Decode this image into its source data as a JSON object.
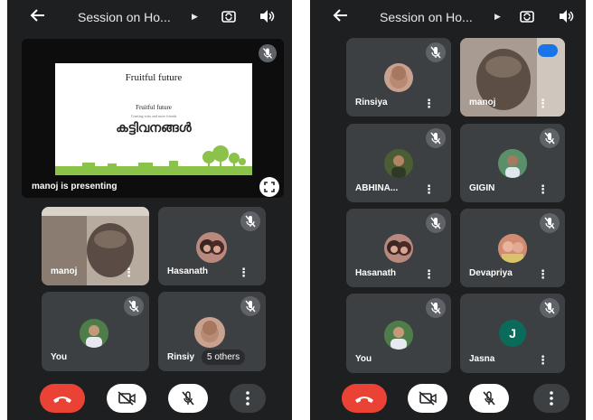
{
  "left": {
    "title": "Session on Ho...",
    "slide": {
      "heading": "Fruitful future",
      "subheading": "Fruitful future",
      "small_text": "Creating wins and more friends",
      "main_text": "കട്ടിവനങ്ങൾ"
    },
    "presenting_label": "manoj is presenting",
    "tiles": [
      {
        "name": "manoj"
      },
      {
        "name": "Hasanath"
      },
      {
        "name": "You"
      },
      {
        "name": "Rinsiy"
      }
    ],
    "others_label": "5 others"
  },
  "right": {
    "title": "Session on Ho...",
    "tiles": [
      {
        "name": "Rinsiya"
      },
      {
        "name": "manoj"
      },
      {
        "name": "ABHINA..."
      },
      {
        "name": "GIGIN"
      },
      {
        "name": "Hasanath"
      },
      {
        "name": "Devapriya"
      },
      {
        "name": "You"
      },
      {
        "name": "Jasna",
        "initial": "J"
      }
    ]
  },
  "icons": {
    "back": "arrow-left-icon",
    "switch_camera": "switch-camera-icon",
    "speaker": "speaker-icon",
    "mic_off": "mic-off-icon",
    "camera_off": "camera-off-icon",
    "end_call": "end-call-icon",
    "more": "more-vert-icon",
    "fullscreen": "fullscreen-icon"
  },
  "colors": {
    "background": "#1e1f21",
    "tile": "#3c4043",
    "end_call": "#ea4335",
    "accent_blue": "#1a73e8",
    "slide_green": "#8bc34a"
  }
}
